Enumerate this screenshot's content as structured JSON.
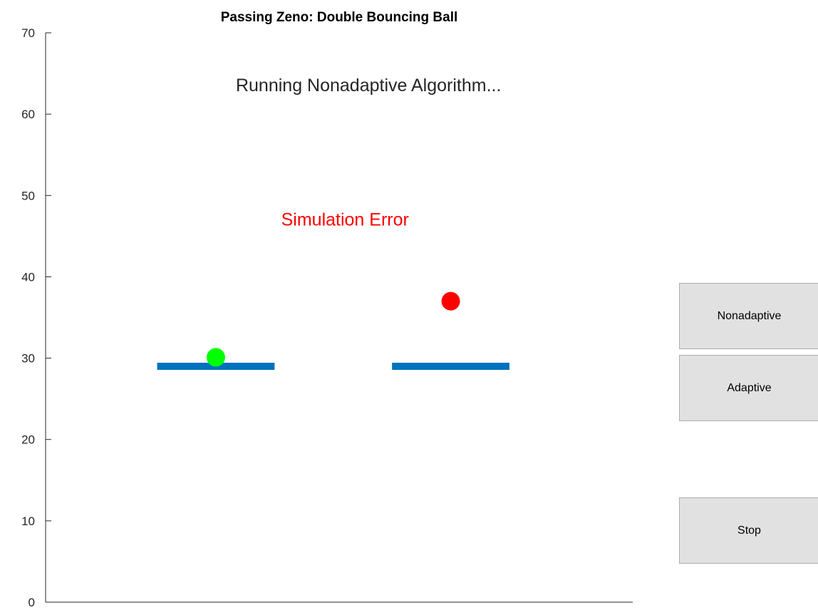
{
  "chart_data": {
    "type": "scatter",
    "title": "Passing Zeno: Double Bouncing Ball",
    "xlabel": "",
    "ylabel": "",
    "ylim": [
      0,
      70
    ],
    "yticks": [
      0,
      10,
      20,
      30,
      40,
      50,
      60,
      70
    ],
    "xlim": [
      0,
      1
    ],
    "xticks": [],
    "grid": false,
    "annotations": [
      {
        "text": "Running Nonadaptive Algorithm...",
        "x": 0.55,
        "y": 62.8,
        "color": "#262626"
      },
      {
        "text": "Simulation Error",
        "x": 0.51,
        "y": 46.3,
        "color": "#ff0000"
      }
    ],
    "platforms": [
      {
        "x_start": 0.19,
        "x_end": 0.39,
        "y": 29,
        "color": "#0072bd"
      },
      {
        "x_start": 0.59,
        "x_end": 0.79,
        "y": 29,
        "color": "#0072bd"
      }
    ],
    "balls": [
      {
        "x": 0.29,
        "y": 30.1,
        "color": "#00ff00"
      },
      {
        "x": 0.69,
        "y": 37,
        "color": "#ff0000"
      }
    ]
  },
  "controls": {
    "nonadaptive_label": "Nonadaptive",
    "adaptive_label": "Adaptive",
    "stop_label": "Stop"
  }
}
